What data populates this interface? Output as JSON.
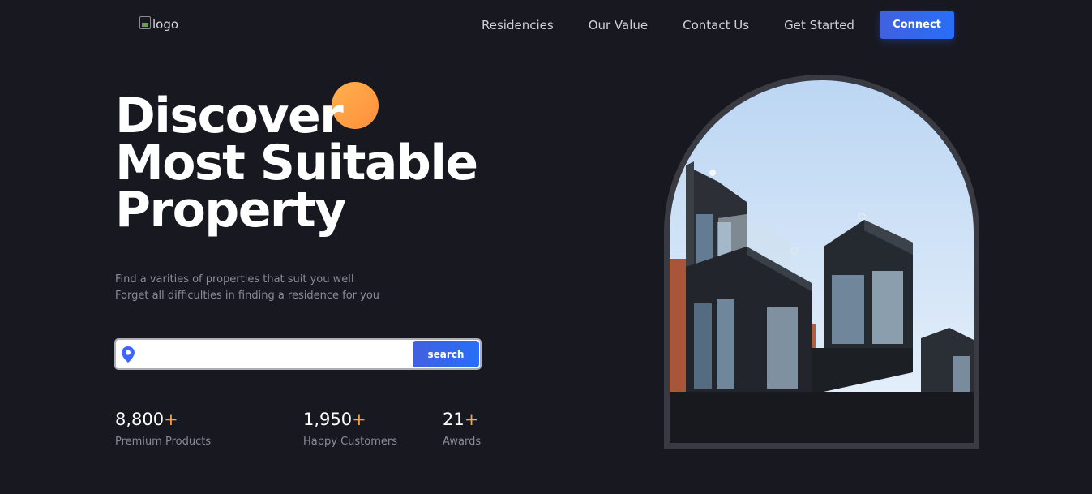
{
  "header": {
    "logo_alt": "logo",
    "nav": [
      "Residencies",
      "Our Value",
      "Contact Us",
      "Get Started"
    ],
    "connect_label": "Connect"
  },
  "hero": {
    "title_lines": [
      "Discover",
      "Most Suitable",
      "Property"
    ],
    "subtitle_lines": [
      "Find a varities of properties that suit you well",
      "Forget all difficulties in finding a residence for you"
    ],
    "search": {
      "placeholder": "",
      "button_label": "search",
      "icon": "location-pin-icon"
    },
    "stats": [
      {
        "value": "8,800",
        "suffix": "+",
        "label": "Premium Products"
      },
      {
        "value": "1,950",
        "suffix": "+",
        "label": "Happy Customers"
      },
      {
        "value": "21",
        "suffix": "+",
        "label": "Awards"
      }
    ]
  },
  "colors": {
    "background": "#181821",
    "accent_blue": "#286ef8",
    "accent_orange": "#ffa63a",
    "muted_text": "#8c8b95"
  }
}
